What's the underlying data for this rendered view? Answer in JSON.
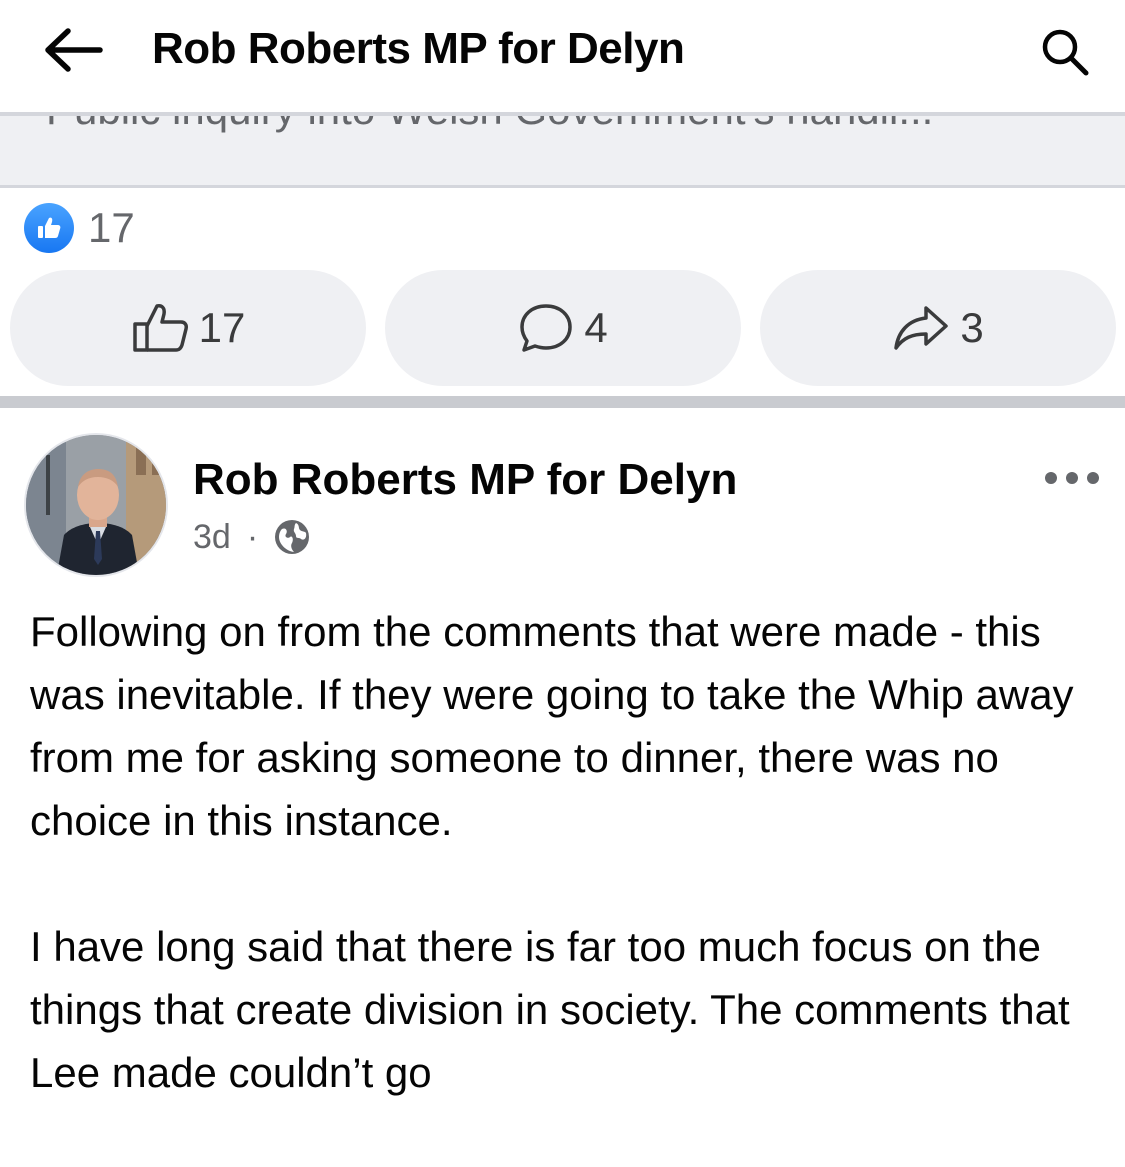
{
  "header": {
    "title": "Rob Roberts MP for Delyn",
    "back_icon": "arrow-left-icon",
    "search_icon": "search-icon"
  },
  "previous_post": {
    "link_title": "Public inquiry into Welsh Government's handli...",
    "reaction_count": "17",
    "actions": {
      "like_count": "17",
      "comment_count": "4",
      "share_count": "3"
    }
  },
  "post": {
    "author": "Rob Roberts MP for Delyn",
    "time": "3d",
    "separator": "·",
    "audience_icon": "globe-icon",
    "more_icon": "more-horizontal-icon",
    "paragraphs": [
      "Following on from the comments that were made - this was inevitable. If they were going to take the Whip away from me for asking someone to dinner, there was no choice in this instance.",
      "I have long said that there is far too much focus on the things that create division in society. The comments that Lee made couldn’t go"
    ]
  },
  "colors": {
    "brand_blue": "#1877f2",
    "secondary_text": "#65676b",
    "button_bg": "#eff0f3"
  }
}
